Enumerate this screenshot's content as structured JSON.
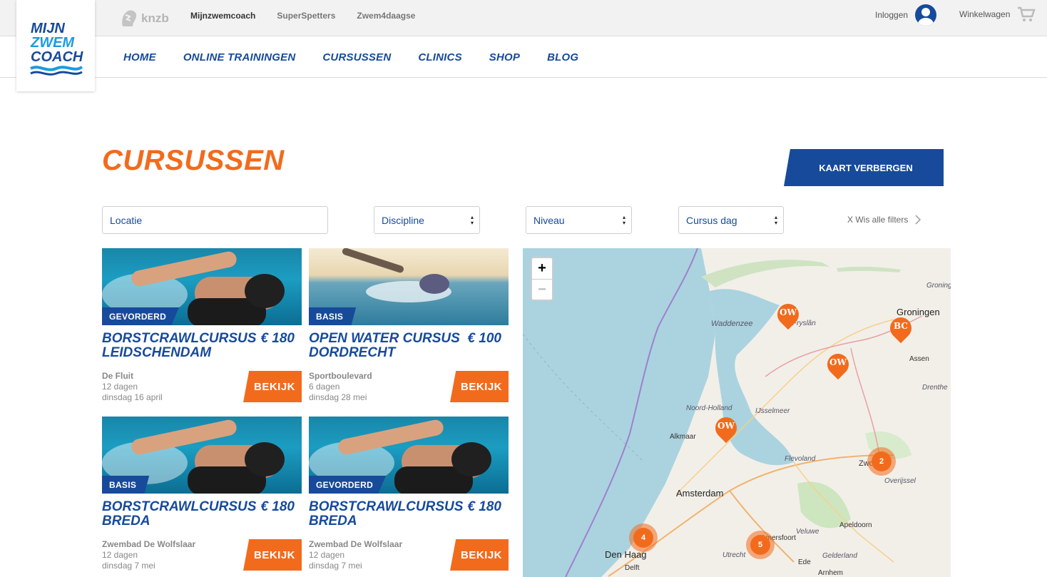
{
  "topbar": {
    "knzb_label": "knzb",
    "links": [
      "Mijnzwemcoach",
      "SuperSpetters",
      "Zwem4daagse"
    ],
    "login_label": "Inloggen",
    "cart_label": "Winkelwagen"
  },
  "logo": {
    "line1": "MIJN",
    "line2": "ZWEM",
    "line3": "COACH"
  },
  "nav": [
    "HOME",
    "ONLINE TRAININGEN",
    "CURSUSSEN",
    "CLINICS",
    "SHOP",
    "BLOG"
  ],
  "page": {
    "title": "CURSUSSEN",
    "map_toggle_label": "KAART VERBERGEN"
  },
  "filters": {
    "location_placeholder": "Locatie",
    "discipline": "Discipline",
    "level": "Niveau",
    "day": "Cursus dag",
    "clear_label": "X Wis alle filters"
  },
  "courses": [
    {
      "level": "GEVORDERD",
      "title": "BORSTCRAWLCURSUS LEIDSCHENDAM",
      "price": "€ 180",
      "venue": "De Fluit",
      "duration": "12 dagen",
      "date": "dinsdag 16 april",
      "button": "BEKIJK",
      "image": "pool"
    },
    {
      "level": "BASIS",
      "title": "OPEN WATER CURSUS DORDRECHT",
      "price": "€ 100",
      "venue": "Sportboulevard",
      "duration": "6 dagen",
      "date": "dinsdag 28 mei",
      "button": "BEKIJK",
      "image": "sea"
    },
    {
      "level": "BASIS",
      "title": "BORSTCRAWLCURSUS BREDA",
      "price": "€ 180",
      "venue": "Zwembad De Wolfslaar",
      "duration": "12 dagen",
      "date": "dinsdag 7 mei",
      "button": "BEKIJK",
      "image": "pool"
    },
    {
      "level": "GEVORDERD",
      "title": "BORSTCRAWLCURSUS BREDA",
      "price": "€ 180",
      "venue": "Zwembad De Wolfslaar",
      "duration": "12 dagen",
      "date": "dinsdag 7 mei",
      "button": "BEKIJK",
      "image": "pool"
    }
  ],
  "map": {
    "zoom_in": "+",
    "zoom_out": "−",
    "labels": {
      "waddenzee": "Waddenzee",
      "groningen": "Groningen",
      "groningen_prov": "Groningen",
      "assen": "Assen",
      "drenthe": "Drenthe",
      "noord_holland": "Noord-Holland",
      "ijsselmeer": "IJsselmeer",
      "alkmaar": "Alkmaar",
      "flevoland": "Flevoland",
      "zwolle": "Zwolle",
      "overijssel": "Overijssel",
      "amsterdam": "Amsterdam",
      "apeldoorn": "Apeldoorn",
      "veluwe": "Veluwe",
      "amersfoort": "Amersfoort",
      "den_haag": "Den Haag",
      "utrecht": "Utrecht",
      "gelderland": "Gelderland",
      "ede": "Ede",
      "delft": "Delft",
      "arnhem": "Arnhem",
      "fryslan": "Fryslân"
    },
    "pins": [
      "OW",
      "BC",
      "OW",
      "OW"
    ],
    "clusters": [
      "2",
      "4",
      "5"
    ]
  }
}
